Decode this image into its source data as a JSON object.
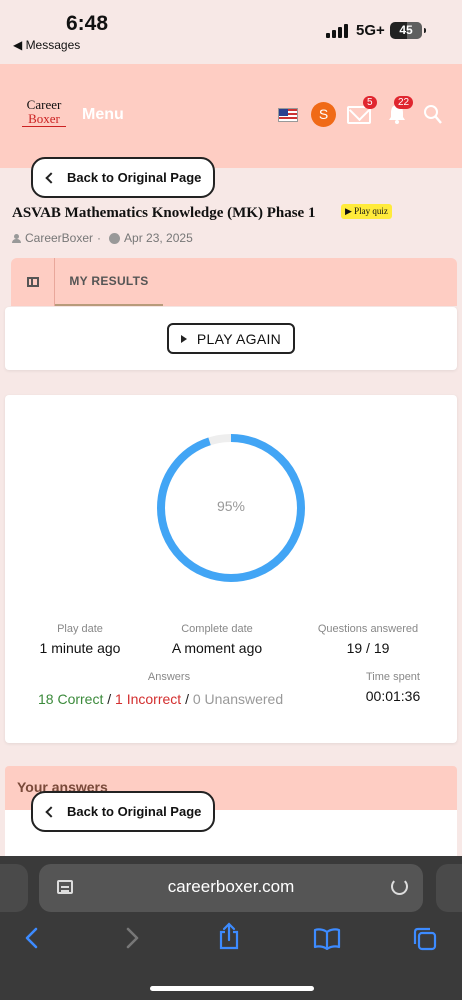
{
  "status_bar": {
    "time": "6:48",
    "back_app": "◀ Messages",
    "network": "5G+",
    "battery": "45"
  },
  "header": {
    "logo_line1": "Career",
    "logo_line2": "Boxer",
    "menu_label": "Menu",
    "avatar_letter": "S",
    "mail_badge": "5",
    "bell_badge": "22"
  },
  "back_button": {
    "label": "Back to Original Page"
  },
  "article": {
    "title": "ASVAB Mathematics Knowledge (MK) Phase 1",
    "quiz_badge": "▶ Play quiz",
    "author": "CareerBoxer",
    "separator": "·",
    "date": "Apr 23, 2025"
  },
  "tabs": {
    "results_label": "MY RESULTS"
  },
  "play_again": {
    "label": "PLAY AGAIN"
  },
  "results": {
    "score_percent": "95%",
    "score_value": 0.95,
    "ring_color": "#42a5f5",
    "stats": {
      "play_date_label": "Play date",
      "play_date_value": "1 minute ago",
      "complete_date_label": "Complete date",
      "complete_date_value": "A moment ago",
      "questions_label": "Questions answered",
      "questions_value": "19 / 19",
      "answers_label": "Answers",
      "correct": "18 Correct",
      "incorrect": "1 Incorrect",
      "unanswered": "0 Unanswered",
      "slash": "/",
      "time_label": "Time spent",
      "time_value": "00:01:36"
    }
  },
  "your_answers": {
    "heading": "Your answers"
  },
  "safari": {
    "url": "careerboxer.com"
  }
}
